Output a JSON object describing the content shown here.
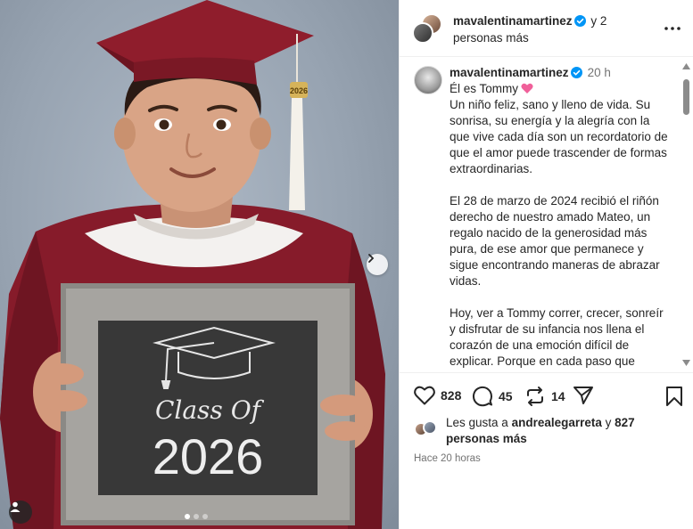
{
  "header": {
    "username": "mavalentinamartinez",
    "collab_text": " y 2 personas más",
    "more_icon": "ellipsis-icon"
  },
  "caption": {
    "username": "mavalentinamartinez",
    "time": "20 h",
    "paragraphs": [
      "Él es Tommy",
      "Un niño feliz, sano y lleno de vida. Su sonrisa, su energía y la alegría con la que vive cada día son un recordatorio de que el amor puede trascender de formas extraordinarias.",
      "El 28 de marzo de 2024 recibió el riñón derecho de nuestro amado Mateo, un regalo nacido de la generosidad más pura, de ese amor que permanece y sigue encontrando maneras de abrazar vidas.",
      "Hoy, ver a Tommy correr, crecer, sonreír y disfrutar de su infancia nos llena el corazón de una emoción difícil de explicar. Porque en cada paso que"
    ]
  },
  "photo": {
    "sign_line1": "Class Of",
    "sign_line2": "2026",
    "tassel_charm": "2026"
  },
  "actions": {
    "likes_count": "828",
    "comments_count": "45",
    "reposts_count": "14"
  },
  "likes": {
    "prefix": "Les gusta a ",
    "user": "andrealegarreta",
    "middle": " y ",
    "others": "827 personas más"
  },
  "timestamp": "Hace 20 horas",
  "colors": {
    "verified": "#0095f6",
    "heart_emoji": "#f0609a",
    "gown": "#8a1d2c",
    "chalkboard": "#3a3a3a"
  },
  "carousel": {
    "current": 1,
    "total": 3
  }
}
